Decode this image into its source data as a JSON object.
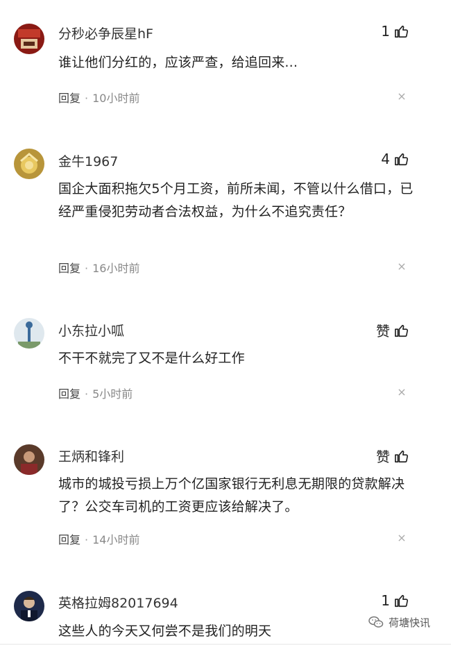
{
  "comments": [
    {
      "username": "分秒必争辰星hF",
      "likes": "1",
      "text": "谁让他们分红的，应该严查，给追回来...",
      "reply_label": "回复",
      "dot": "·",
      "time": "10小时前",
      "close": "×"
    },
    {
      "username": "金牛1967",
      "likes": "4",
      "text": "国企大面积拖欠5个月工资，前所未闻，不管以什么借口，已经严重侵犯劳动者合法权益，为什么不追究责任？",
      "reply_label": "回复",
      "dot": "·",
      "time": "16小时前",
      "close": "×"
    },
    {
      "username": "小东拉小呱",
      "likes": "赞",
      "text": "不干不就完了又不是什么好工作",
      "reply_label": "回复",
      "dot": "·",
      "time": "5小时前",
      "close": "×"
    },
    {
      "username": "王炳和锋利",
      "likes": "赞",
      "text": "城市的城投亏损上万个亿国家银行无利息无期限的贷款解决了？公交车司机的工资更应该给解决了。",
      "reply_label": "回复",
      "dot": "·",
      "time": "14小时前",
      "close": "×"
    },
    {
      "username": "英格拉姆82017694",
      "likes": "1",
      "text": "这些人的今天又何尝不是我们的明天"
    }
  ],
  "watermark": {
    "text": "荷塘快讯"
  },
  "icons": {
    "like": "thumb-up-icon",
    "close": "close-icon",
    "watermark": "wechat-icon"
  }
}
